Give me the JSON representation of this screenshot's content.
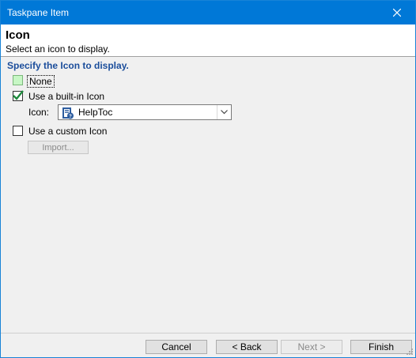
{
  "window": {
    "title": "Taskpane Item"
  },
  "header": {
    "title": "Icon",
    "subtitle": "Select an icon to display."
  },
  "section": {
    "title": "Specify the Icon to display."
  },
  "options": {
    "none": {
      "label": "None",
      "checked": false
    },
    "builtin": {
      "label": "Use a built-in Icon",
      "checked": true
    },
    "custom": {
      "label": "Use a custom Icon",
      "checked": false
    }
  },
  "icon_select": {
    "label": "Icon:",
    "value": "HelpToc"
  },
  "import_button": {
    "label": "Import...",
    "enabled": false
  },
  "footer": {
    "cancel": "Cancel",
    "back": "< Back",
    "next": "Next >",
    "finish": "Finish"
  },
  "colors": {
    "titlebar": "#0078d7",
    "section_title": "#1b4d9b",
    "check": "#1d8a3c"
  }
}
